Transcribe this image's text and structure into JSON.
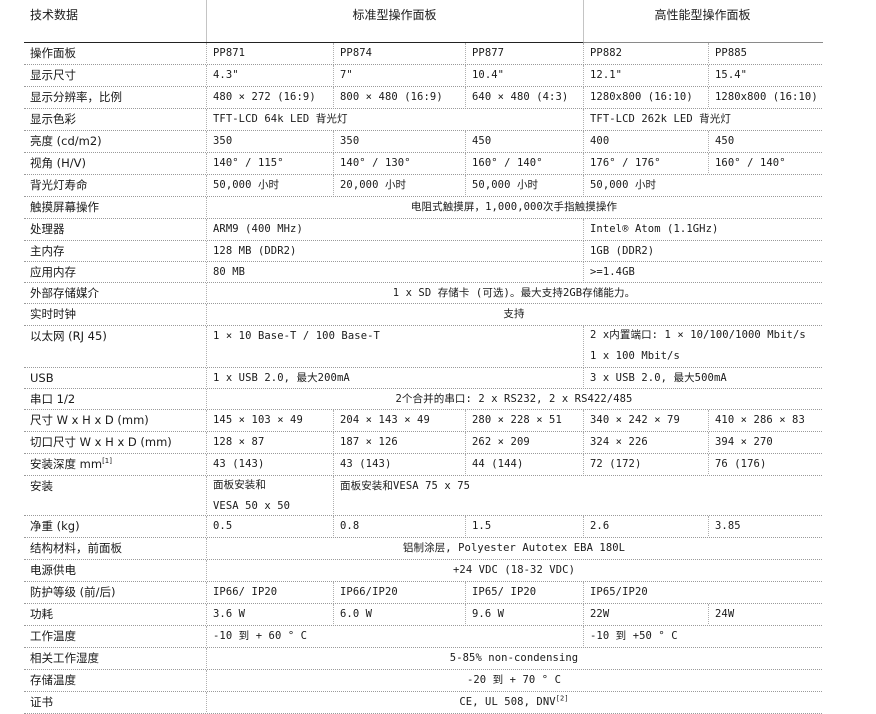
{
  "header": {
    "col_label": "技术数据",
    "standard_group": "标准型操作面板",
    "high_group": "高性能型操作面板"
  },
  "rows": [
    {
      "label": "操作面板",
      "cells": [
        {
          "text": "PP871",
          "span": [
            1,
            1
          ]
        },
        {
          "text": "PP874",
          "span": [
            2,
            2
          ]
        },
        {
          "text": "PP877",
          "span": [
            3,
            3
          ]
        },
        {
          "text": "PP882",
          "span": [
            4,
            4
          ]
        },
        {
          "text": "PP885",
          "span": [
            5,
            5
          ]
        }
      ]
    },
    {
      "label": "显示尺寸",
      "cells": [
        {
          "text": "4.3\"",
          "span": [
            1,
            1
          ]
        },
        {
          "text": "7\"",
          "span": [
            2,
            2
          ]
        },
        {
          "text": "10.4\"",
          "span": [
            3,
            3
          ]
        },
        {
          "text": "12.1\"",
          "span": [
            4,
            4
          ]
        },
        {
          "text": "15.4\"",
          "span": [
            5,
            5
          ]
        }
      ]
    },
    {
      "label": "显示分辨率，比例",
      "cells": [
        {
          "text": "480 × 272 (16:9)",
          "span": [
            1,
            1
          ]
        },
        {
          "text": "800 × 480 (16:9)",
          "span": [
            2,
            2
          ]
        },
        {
          "text": "640 × 480 (4:3)",
          "span": [
            3,
            3
          ]
        },
        {
          "text": "1280x800 (16:10)",
          "span": [
            4,
            4
          ]
        },
        {
          "text": "1280x800 (16:10)",
          "span": [
            5,
            5
          ]
        }
      ]
    },
    {
      "label": "显示色彩",
      "cells": [
        {
          "text": "TFT-LCD 64k LED 背光灯",
          "span": [
            1,
            3
          ]
        },
        {
          "text": "TFT-LCD 262k LED 背光灯",
          "span": [
            4,
            5
          ]
        }
      ]
    },
    {
      "label": "亮度 (cd/m2)",
      "cells": [
        {
          "text": "350",
          "span": [
            1,
            1
          ]
        },
        {
          "text": "350",
          "span": [
            2,
            2
          ]
        },
        {
          "text": "450",
          "span": [
            3,
            3
          ]
        },
        {
          "text": "400",
          "span": [
            4,
            4
          ]
        },
        {
          "text": "450",
          "span": [
            5,
            5
          ]
        }
      ]
    },
    {
      "label": "视角 (H/V)",
      "cells": [
        {
          "text": "140° / 115°",
          "span": [
            1,
            1
          ]
        },
        {
          "text": "140° / 130°",
          "span": [
            2,
            2
          ]
        },
        {
          "text": "160° / 140°",
          "span": [
            3,
            3
          ]
        },
        {
          "text": "176° / 176°",
          "span": [
            4,
            4
          ]
        },
        {
          "text": "160° / 140°",
          "span": [
            5,
            5
          ]
        }
      ]
    },
    {
      "label": "背光灯寿命",
      "cells": [
        {
          "text": "50,000 小时",
          "span": [
            1,
            1
          ]
        },
        {
          "text": "20,000 小时",
          "span": [
            2,
            2
          ]
        },
        {
          "text": "50,000 小时",
          "span": [
            3,
            3
          ]
        },
        {
          "text": "50,000 小时",
          "span": [
            4,
            4
          ]
        }
      ]
    },
    {
      "label": "触摸屏幕操作",
      "cells": [
        {
          "text": "电阻式触摸屏，1,000,000次手指触摸操作",
          "span": [
            1,
            5
          ],
          "center": true
        }
      ]
    },
    {
      "label": "处理器",
      "cells": [
        {
          "text": "ARM9 (400 MHz)",
          "span": [
            1,
            3
          ]
        },
        {
          "text": "Intel® Atom (1.1GHz)",
          "span": [
            4,
            5
          ]
        }
      ]
    },
    {
      "label": "主内存",
      "cells": [
        {
          "text": "128 MB (DDR2)",
          "span": [
            1,
            3
          ]
        },
        {
          "text": "1GB (DDR2)",
          "span": [
            4,
            5
          ]
        }
      ]
    },
    {
      "label": "应用内存",
      "cells": [
        {
          "text": "80 MB",
          "span": [
            1,
            3
          ]
        },
        {
          "text": ">=1.4GB",
          "span": [
            4,
            5
          ]
        }
      ]
    },
    {
      "label": "外部存储媒介",
      "cells": [
        {
          "text": "1 x SD 存储卡 (可选)。最大支持2GB存储能力。",
          "span": [
            1,
            5
          ],
          "center": true
        }
      ]
    },
    {
      "label": "实时时钟",
      "cells": [
        {
          "text": "支持",
          "span": [
            1,
            5
          ],
          "center": true
        }
      ]
    },
    {
      "label": "以太网 (RJ 45)",
      "cells": [
        {
          "text": "1 × 10 Base-T / 100 Base-T",
          "span": [
            1,
            3
          ]
        },
        {
          "lines": [
            "2 x内置端口: 1 × 10/100/1000 Mbit/s",
            "1 x 100 Mbit/s"
          ],
          "span": [
            4,
            5
          ]
        }
      ]
    },
    {
      "label": "USB",
      "cells": [
        {
          "text": "1 x USB 2.0, 最大200mA",
          "span": [
            1,
            3
          ]
        },
        {
          "text": "3 x USB 2.0, 最大500mA",
          "span": [
            4,
            5
          ]
        }
      ]
    },
    {
      "label": "串口 1/2",
      "cells": [
        {
          "text": "2个合并的串口: 2 x RS232, 2 x RS422/485",
          "span": [
            1,
            5
          ],
          "center": true
        }
      ]
    },
    {
      "label": "尺寸 W x H x D (mm)",
      "cells": [
        {
          "text": "145 × 103 × 49",
          "span": [
            1,
            1
          ]
        },
        {
          "text": "204 × 143 × 49",
          "span": [
            2,
            2
          ]
        },
        {
          "text": "280 × 228 × 51",
          "span": [
            3,
            3
          ]
        },
        {
          "text": "340 × 242 × 79",
          "span": [
            4,
            4
          ]
        },
        {
          "text": "410 × 286 × 83",
          "span": [
            5,
            5
          ]
        }
      ]
    },
    {
      "label": "切口尺寸 W x H x D (mm)",
      "cells": [
        {
          "text": "128 × 87",
          "span": [
            1,
            1
          ]
        },
        {
          "text": "187 × 126",
          "span": [
            2,
            2
          ]
        },
        {
          "text": "262 × 209",
          "span": [
            3,
            3
          ]
        },
        {
          "text": "324 × 226",
          "span": [
            4,
            4
          ]
        },
        {
          "text": "394 × 270",
          "span": [
            5,
            5
          ]
        }
      ]
    },
    {
      "label": "安装深度 mm",
      "label_sup": "[1]",
      "cells": [
        {
          "text": "43 (143)",
          "span": [
            1,
            1
          ]
        },
        {
          "text": "43 (143)",
          "span": [
            2,
            2
          ]
        },
        {
          "text": "44 (144)",
          "span": [
            3,
            3
          ]
        },
        {
          "text": "72 (172)",
          "span": [
            4,
            4
          ]
        },
        {
          "text": "76 (176)",
          "span": [
            5,
            5
          ]
        }
      ]
    },
    {
      "label": "安装",
      "cells": [
        {
          "lines": [
            "面板安装和",
            "VESA 50 x 50"
          ],
          "span": [
            1,
            1
          ]
        },
        {
          "text": "面板安装和VESA 75 x 75",
          "span": [
            2,
            5
          ]
        }
      ]
    },
    {
      "label": "净重 (kg)",
      "cells": [
        {
          "text": "0.5",
          "span": [
            1,
            1
          ]
        },
        {
          "text": "0.8",
          "span": [
            2,
            2
          ]
        },
        {
          "text": "1.5",
          "span": [
            3,
            3
          ]
        },
        {
          "text": "2.6",
          "span": [
            4,
            4
          ]
        },
        {
          "text": "3.85",
          "span": [
            5,
            5
          ]
        }
      ]
    },
    {
      "label": "结构材料，前面板",
      "cells": [
        {
          "text": "铝制涂层, Polyester Autotex EBA 180L",
          "span": [
            1,
            5
          ],
          "center": true
        }
      ]
    },
    {
      "label": "电源供电",
      "cells": [
        {
          "text": "+24 VDC (18-32 VDC)",
          "span": [
            1,
            5
          ],
          "center": true
        }
      ]
    },
    {
      "label": "防护等级 (前/后)",
      "cells": [
        {
          "text": "IP66/ IP20",
          "span": [
            1,
            1
          ]
        },
        {
          "text": "IP66/IP20",
          "span": [
            2,
            2
          ]
        },
        {
          "text": "IP65/ IP20",
          "span": [
            3,
            3
          ]
        },
        {
          "text": "IP65/IP20",
          "span": [
            4,
            5
          ]
        }
      ]
    },
    {
      "label": "功耗",
      "cells": [
        {
          "text": "3.6 W",
          "span": [
            1,
            1
          ]
        },
        {
          "text": "6.0 W",
          "span": [
            2,
            2
          ]
        },
        {
          "text": "9.6 W",
          "span": [
            3,
            3
          ]
        },
        {
          "text": "22W",
          "span": [
            4,
            4
          ]
        },
        {
          "text": "24W",
          "span": [
            5,
            5
          ]
        }
      ]
    },
    {
      "label": "工作温度",
      "cells": [
        {
          "text": "-10 到 + 60 ° C",
          "span": [
            1,
            3
          ]
        },
        {
          "text": "-10 到 +50 ° C",
          "span": [
            4,
            5
          ]
        }
      ]
    },
    {
      "label": "相关工作湿度",
      "cells": [
        {
          "text": "5-85% non-condensing",
          "span": [
            1,
            5
          ],
          "center": true
        }
      ]
    },
    {
      "label": "存储温度",
      "cells": [
        {
          "text": "-20 到 + 70 ° C",
          "span": [
            1,
            5
          ],
          "center": true
        }
      ]
    },
    {
      "label": "证书",
      "cells": [
        {
          "text": "CE, UL 508, DNV",
          "sup": "[2]",
          "span": [
            1,
            5
          ],
          "center": true
        }
      ]
    }
  ]
}
